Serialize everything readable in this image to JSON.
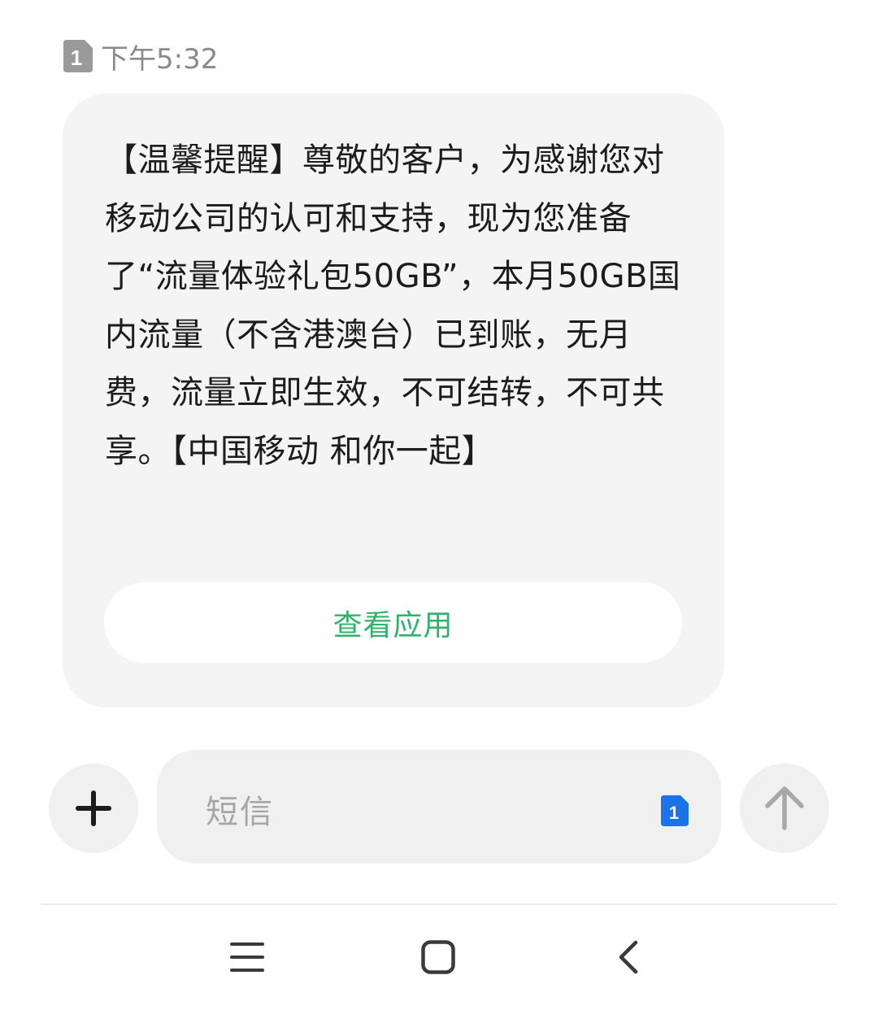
{
  "message": {
    "sim_slot": "1",
    "time": "下午5:32",
    "body": "【温馨提醒】尊敬的客户，为感谢您对移动公司的认可和支持，现为您准备了“流量体验礼包50GB”，本月50GB国内流量（不含港澳台）已到账，无月费，流量立即生效，不可结转，不可共享。【中国移动 和你一起】",
    "action_label": "查看应用"
  },
  "composer": {
    "placeholder": "短信",
    "sim_slot": "1",
    "add_icon": "plus-icon",
    "send_icon": "arrow-up-icon"
  },
  "navbar": {
    "menu_icon": "menu-icon",
    "home_icon": "home-icon",
    "back_icon": "back-icon"
  },
  "colors": {
    "accent_green": "#2cb56a",
    "sim_badge_blue": "#1a73e8",
    "bubble_bg": "#f4f4f4"
  }
}
